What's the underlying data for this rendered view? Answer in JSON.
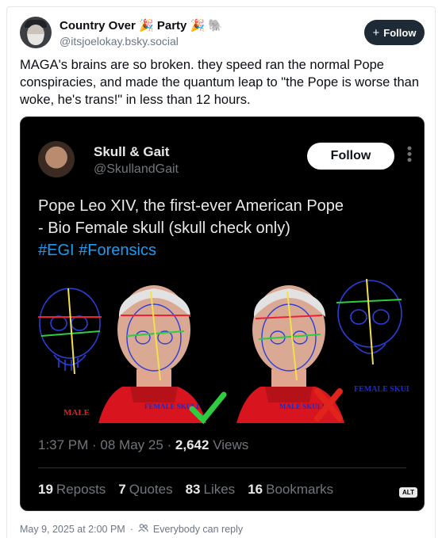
{
  "post": {
    "author_name": "Country Over 🎉 Party 🎉 🐘",
    "author_handle": "@itsjoelokay.bsky.social",
    "follow_label": "Follow",
    "follow_icon": "plus-icon",
    "text": "MAGA's brains are so broken. they speed ran the normal Pope conspiracies, and made the quantum leap to \"the Pope is worse than woke, he's trans!\" in less than 12 hours.",
    "timestamp": "May 9, 2025 at 2:00 PM",
    "reply_setting": "Everybody can reply"
  },
  "embed": {
    "author_name": "Skull & Gait",
    "author_handle": "@SkullandGait",
    "follow_label": "Follow",
    "text_line1": "Pope Leo XIV, the first-ever American Pope",
    "text_line2": "- Bio Female skull (skull check only)",
    "hashtag1": "#EGI",
    "hashtag2": "#Forensics",
    "image_labels": {
      "male_left": "MALE",
      "female_mid": "FEMALE SKULL",
      "male_mid": "MALE SKULL",
      "female_right": "FEMALE SKULL"
    },
    "time": "1:37 PM",
    "date": "08 May 25",
    "views_count": "2,642",
    "views_label": "Views",
    "stats": [
      {
        "count": "19",
        "label": "Reposts"
      },
      {
        "count": "7",
        "label": "Quotes"
      },
      {
        "count": "83",
        "label": "Likes"
      },
      {
        "count": "16",
        "label": "Bookmarks"
      }
    ],
    "alt_badge": "ALT"
  },
  "colors": {
    "follow_button_bg": "#1e2a36",
    "hashtag": "#1d9bf0",
    "check": "#2ecc40",
    "cross": "#e0231b"
  }
}
